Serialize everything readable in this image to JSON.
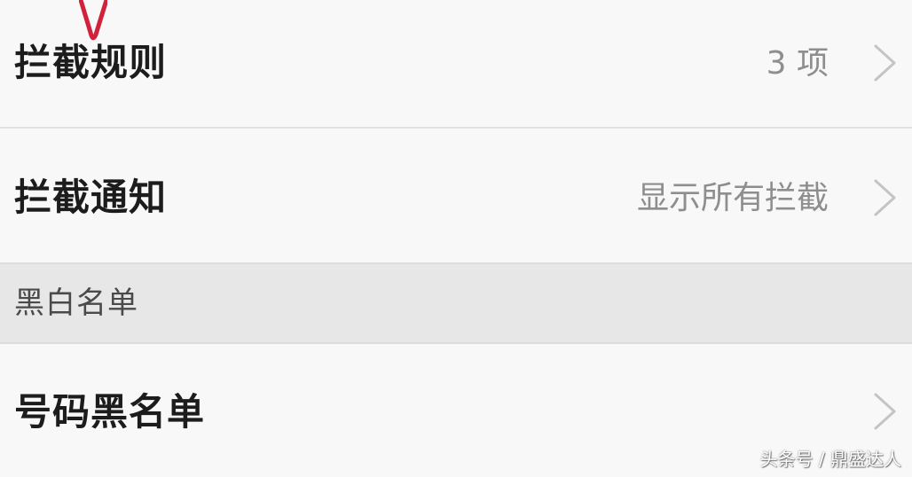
{
  "settings": {
    "rows": [
      {
        "label": "拦截规则",
        "value": "3 项"
      },
      {
        "label": "拦截通知",
        "value": "显示所有拦截"
      }
    ],
    "section_header": "黑白名单",
    "blacklist_row": {
      "label": "号码黑名单"
    }
  },
  "watermark": "头条号 / 鼎盛达人",
  "icons": {
    "chevron": "chevron-right-icon",
    "annotation": "red-check-mark"
  },
  "colors": {
    "background": "#f8f8f8",
    "section_header_bg": "#e7e7e7",
    "label_text": "#1c1c1c",
    "value_text": "#8e8e8e",
    "chevron": "#c4c4c4",
    "annotation": "#d0223a"
  }
}
